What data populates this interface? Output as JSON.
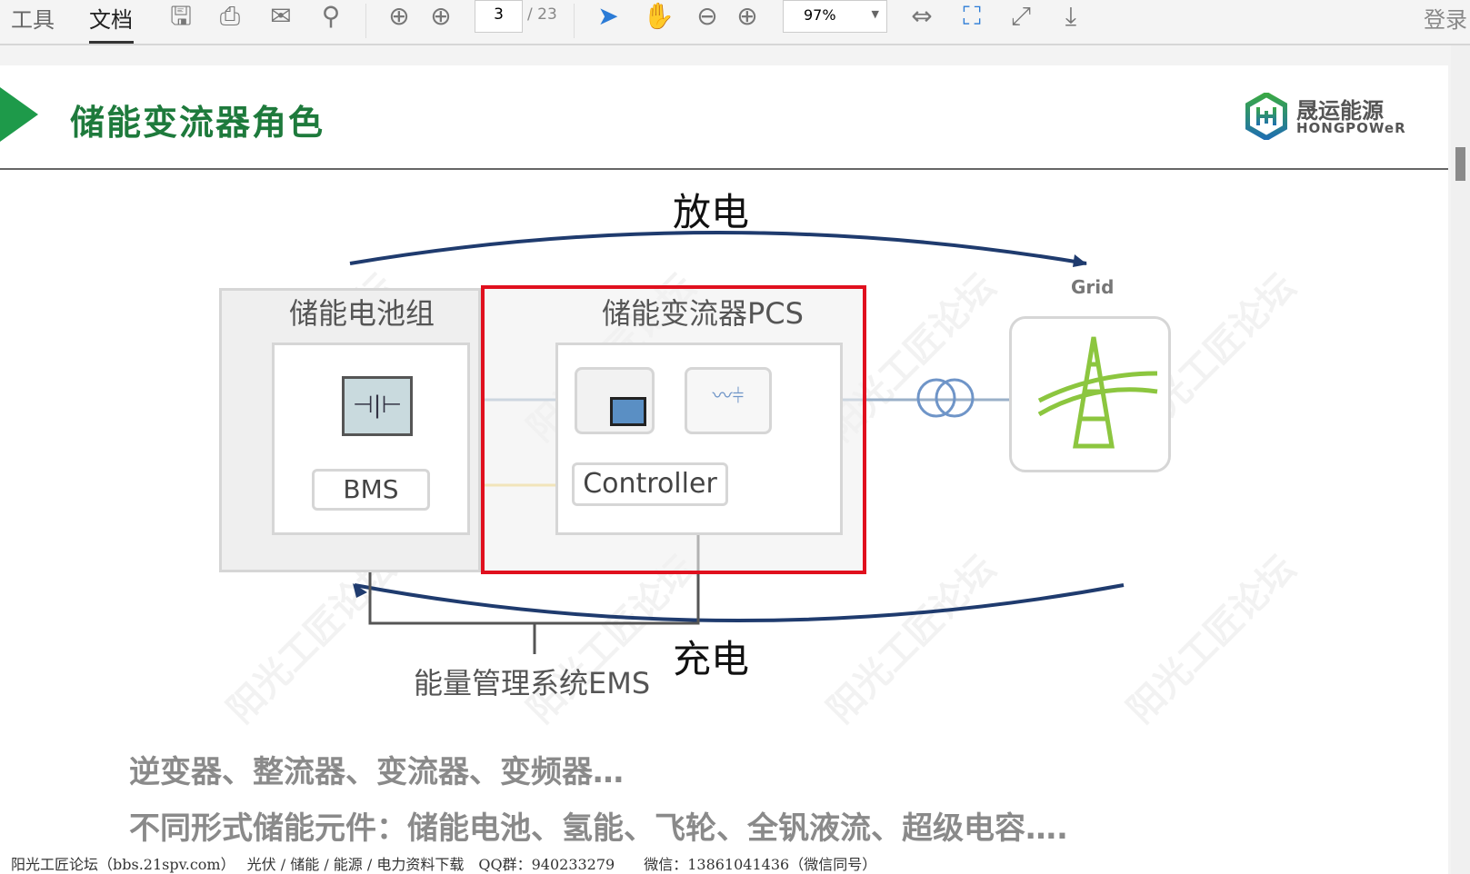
{
  "toolbar": {
    "tools_tab": "工具",
    "document_tab": "文档",
    "page_current": "3",
    "page_total": "/ 23",
    "zoom": "97%",
    "login": "登录",
    "icons": [
      "save-icon",
      "print-icon",
      "email-icon",
      "search-icon",
      "prev-page-icon",
      "next-page-icon",
      "select-cursor-icon",
      "hand-tool-icon",
      "zoom-out-icon",
      "zoom-in-icon",
      "fit-width-icon",
      "fit-page-icon",
      "fullscreen-icon",
      "read-mode-icon"
    ],
    "accent": "#2b7bd6"
  },
  "slide": {
    "title": "储能变流器角色",
    "title_color": "#1e7a3c",
    "logo": {
      "cn": "晟运能源",
      "en": "HONGPOWeR"
    },
    "discharge": "放电",
    "charge": "充电",
    "battery_group": "储能电池组",
    "pcs": "储能变流器PCS",
    "bms": "BMS",
    "controller": "Controller",
    "grid": "Grid",
    "ems": "能量管理系统EMS",
    "highlight_color": "#e0101e",
    "bullets": [
      "逆变器、整流器、变流器、变频器…",
      "不同形式储能元件：储能电池、氢能、飞轮、全钒液流、超级电容…."
    ],
    "watermark": "阳光工匠论坛",
    "footer": "阳光工匠论坛（bbs.21spv.com）　 光伏 / 储能 / 能源 / 电力资料下载　QQ群：940233279　　微信：13861041436（微信同号）"
  }
}
